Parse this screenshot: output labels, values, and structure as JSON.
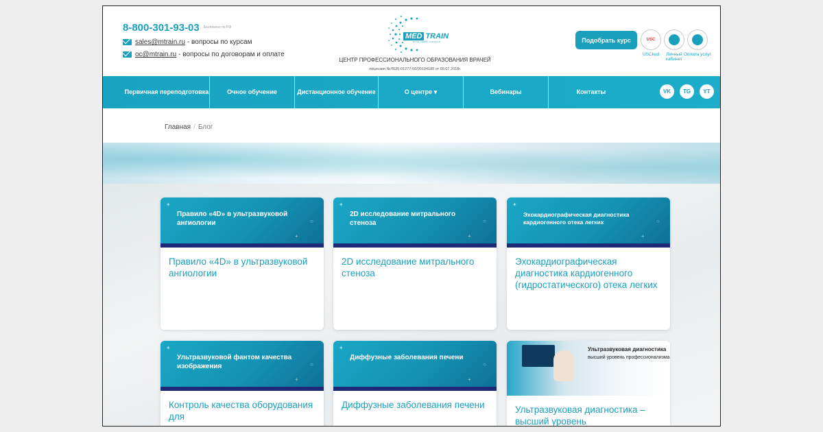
{
  "header": {
    "phone": "8-800-301-93-03",
    "phone_note": "Бесплатно по РФ",
    "emails": [
      {
        "address": "sales@mtrain.ru",
        "desc": "- вопросы по курсам"
      },
      {
        "address": "oc@mtrain.ru",
        "desc": "- вопросы по договорам и оплате"
      }
    ],
    "logo_med": "MED",
    "logo_train": "TRAIN",
    "logo_sub": "ЕСТЬ ЧЕМУ УЧИТЬСЯ",
    "center_title": "ЦЕНТР ПРОФЕССИОНАЛЬНОГО ОБРАЗОВАНИЯ ВРАЧЕЙ",
    "license": "лицензия №Л035-01277-66/00194188 от 09.07.2018г.",
    "pick_button": "Подобрать курс",
    "icons": [
      {
        "name": "usckud-icon",
        "label": "USCkud",
        "badge": "USC"
      },
      {
        "name": "user-icon",
        "label": "Личный кабинет"
      },
      {
        "name": "coins-icon",
        "label": "Оплата услуг"
      }
    ]
  },
  "nav": {
    "items": [
      "Первичная переподготовка",
      "Очное обучение",
      "Дистанционное обучение",
      "О центре ▾",
      "Вебинары",
      "Контакты"
    ],
    "social": [
      "VK",
      "TG",
      "YT"
    ]
  },
  "breadcrumb": {
    "home": "Главная",
    "separator": "/",
    "current": "Блог"
  },
  "cards": [
    {
      "caption": "Правило «4D» в ультразвуковой ангиологии",
      "title": "Правило «4D» в ультразвуковой ангиологии"
    },
    {
      "caption": "2D исследование митрального стеноза",
      "title": "2D исследование митрального стеноза"
    },
    {
      "caption": "Эхокардиографическая диагностика кардиогенного отека легких",
      "title": "Эхокардиографическая диагностика кардиогенного (гидростатического) отека легких"
    },
    {
      "caption": "Ультразвуковой фантом качества изображения",
      "title": "Контроль качества оборудования для"
    },
    {
      "caption": "Диффузные заболевания печени",
      "title": "Диффузные заболевания печени"
    },
    {
      "caption": "Ультразвуковая диагностика",
      "caption2": "высший уровень профессионализма",
      "title": "Ультразвуковая диагностика – высший уровень"
    }
  ],
  "colors": {
    "accent": "#1aa0bd",
    "nav": "#18a3c1",
    "band": "#1e2a78"
  }
}
